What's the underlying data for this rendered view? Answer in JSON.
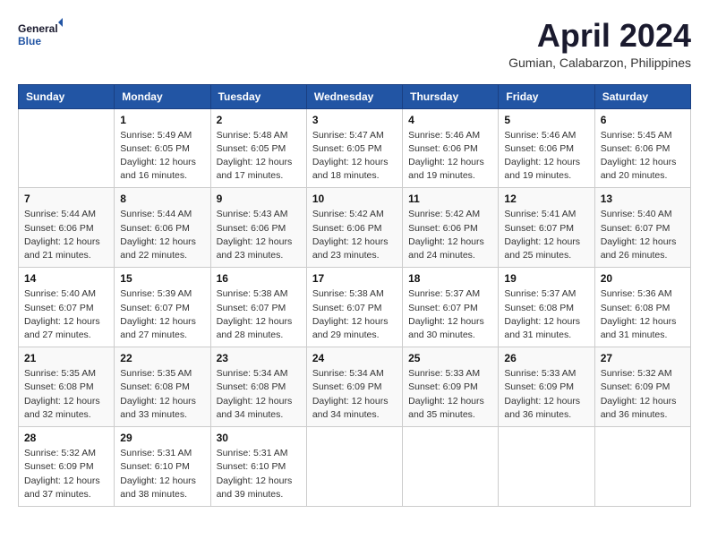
{
  "header": {
    "logo_line1": "General",
    "logo_line2": "Blue",
    "month_title": "April 2024",
    "location": "Gumian, Calabarzon, Philippines"
  },
  "days_of_week": [
    "Sunday",
    "Monday",
    "Tuesday",
    "Wednesday",
    "Thursday",
    "Friday",
    "Saturday"
  ],
  "weeks": [
    [
      {
        "day": "",
        "info": ""
      },
      {
        "day": "1",
        "info": "Sunrise: 5:49 AM\nSunset: 6:05 PM\nDaylight: 12 hours\nand 16 minutes."
      },
      {
        "day": "2",
        "info": "Sunrise: 5:48 AM\nSunset: 6:05 PM\nDaylight: 12 hours\nand 17 minutes."
      },
      {
        "day": "3",
        "info": "Sunrise: 5:47 AM\nSunset: 6:05 PM\nDaylight: 12 hours\nand 18 minutes."
      },
      {
        "day": "4",
        "info": "Sunrise: 5:46 AM\nSunset: 6:06 PM\nDaylight: 12 hours\nand 19 minutes."
      },
      {
        "day": "5",
        "info": "Sunrise: 5:46 AM\nSunset: 6:06 PM\nDaylight: 12 hours\nand 19 minutes."
      },
      {
        "day": "6",
        "info": "Sunrise: 5:45 AM\nSunset: 6:06 PM\nDaylight: 12 hours\nand 20 minutes."
      }
    ],
    [
      {
        "day": "7",
        "info": "Sunrise: 5:44 AM\nSunset: 6:06 PM\nDaylight: 12 hours\nand 21 minutes."
      },
      {
        "day": "8",
        "info": "Sunrise: 5:44 AM\nSunset: 6:06 PM\nDaylight: 12 hours\nand 22 minutes."
      },
      {
        "day": "9",
        "info": "Sunrise: 5:43 AM\nSunset: 6:06 PM\nDaylight: 12 hours\nand 23 minutes."
      },
      {
        "day": "10",
        "info": "Sunrise: 5:42 AM\nSunset: 6:06 PM\nDaylight: 12 hours\nand 23 minutes."
      },
      {
        "day": "11",
        "info": "Sunrise: 5:42 AM\nSunset: 6:06 PM\nDaylight: 12 hours\nand 24 minutes."
      },
      {
        "day": "12",
        "info": "Sunrise: 5:41 AM\nSunset: 6:07 PM\nDaylight: 12 hours\nand 25 minutes."
      },
      {
        "day": "13",
        "info": "Sunrise: 5:40 AM\nSunset: 6:07 PM\nDaylight: 12 hours\nand 26 minutes."
      }
    ],
    [
      {
        "day": "14",
        "info": "Sunrise: 5:40 AM\nSunset: 6:07 PM\nDaylight: 12 hours\nand 27 minutes."
      },
      {
        "day": "15",
        "info": "Sunrise: 5:39 AM\nSunset: 6:07 PM\nDaylight: 12 hours\nand 27 minutes."
      },
      {
        "day": "16",
        "info": "Sunrise: 5:38 AM\nSunset: 6:07 PM\nDaylight: 12 hours\nand 28 minutes."
      },
      {
        "day": "17",
        "info": "Sunrise: 5:38 AM\nSunset: 6:07 PM\nDaylight: 12 hours\nand 29 minutes."
      },
      {
        "day": "18",
        "info": "Sunrise: 5:37 AM\nSunset: 6:07 PM\nDaylight: 12 hours\nand 30 minutes."
      },
      {
        "day": "19",
        "info": "Sunrise: 5:37 AM\nSunset: 6:08 PM\nDaylight: 12 hours\nand 31 minutes."
      },
      {
        "day": "20",
        "info": "Sunrise: 5:36 AM\nSunset: 6:08 PM\nDaylight: 12 hours\nand 31 minutes."
      }
    ],
    [
      {
        "day": "21",
        "info": "Sunrise: 5:35 AM\nSunset: 6:08 PM\nDaylight: 12 hours\nand 32 minutes."
      },
      {
        "day": "22",
        "info": "Sunrise: 5:35 AM\nSunset: 6:08 PM\nDaylight: 12 hours\nand 33 minutes."
      },
      {
        "day": "23",
        "info": "Sunrise: 5:34 AM\nSunset: 6:08 PM\nDaylight: 12 hours\nand 34 minutes."
      },
      {
        "day": "24",
        "info": "Sunrise: 5:34 AM\nSunset: 6:09 PM\nDaylight: 12 hours\nand 34 minutes."
      },
      {
        "day": "25",
        "info": "Sunrise: 5:33 AM\nSunset: 6:09 PM\nDaylight: 12 hours\nand 35 minutes."
      },
      {
        "day": "26",
        "info": "Sunrise: 5:33 AM\nSunset: 6:09 PM\nDaylight: 12 hours\nand 36 minutes."
      },
      {
        "day": "27",
        "info": "Sunrise: 5:32 AM\nSunset: 6:09 PM\nDaylight: 12 hours\nand 36 minutes."
      }
    ],
    [
      {
        "day": "28",
        "info": "Sunrise: 5:32 AM\nSunset: 6:09 PM\nDaylight: 12 hours\nand 37 minutes."
      },
      {
        "day": "29",
        "info": "Sunrise: 5:31 AM\nSunset: 6:10 PM\nDaylight: 12 hours\nand 38 minutes."
      },
      {
        "day": "30",
        "info": "Sunrise: 5:31 AM\nSunset: 6:10 PM\nDaylight: 12 hours\nand 39 minutes."
      },
      {
        "day": "",
        "info": ""
      },
      {
        "day": "",
        "info": ""
      },
      {
        "day": "",
        "info": ""
      },
      {
        "day": "",
        "info": ""
      }
    ]
  ]
}
